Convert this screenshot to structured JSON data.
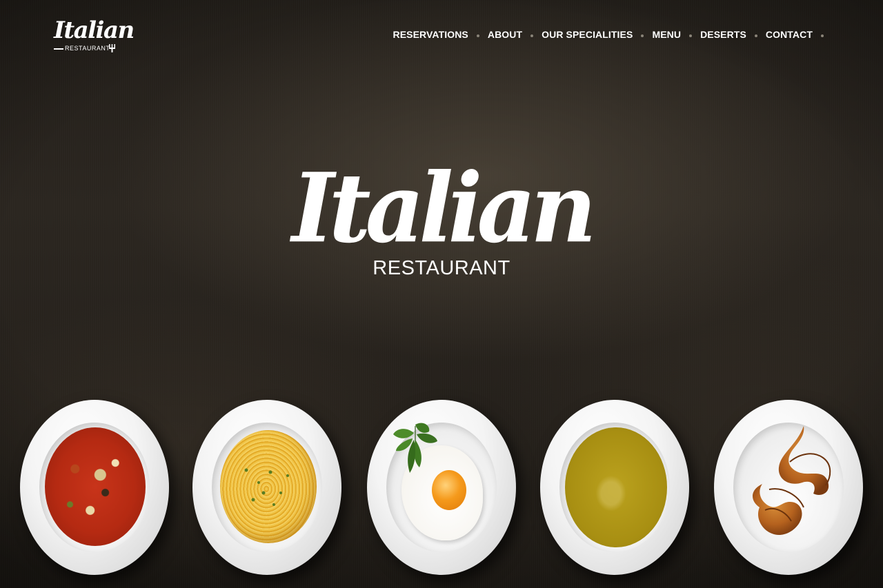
{
  "logo": {
    "script_text": "Italian",
    "sub_text": "RESTAURANT"
  },
  "nav": {
    "items": [
      {
        "label": "RESERVATIONS"
      },
      {
        "label": "ABOUT"
      },
      {
        "label": "OUR SPECIALITIES"
      },
      {
        "label": "MENU"
      },
      {
        "label": "DESERTS"
      },
      {
        "label": "CONTACT"
      }
    ]
  },
  "hero": {
    "title": "Italian",
    "subtitle": "RESTAURANT"
  },
  "plates": [
    {
      "dish": "minestrone-soup"
    },
    {
      "dish": "spaghetti"
    },
    {
      "dish": "fried-egg"
    },
    {
      "dish": "cream-soup"
    },
    {
      "dish": "croissants"
    }
  ],
  "colors": {
    "background": "#1e1b17",
    "text": "#ffffff",
    "nav_dot": "#8a8478"
  }
}
